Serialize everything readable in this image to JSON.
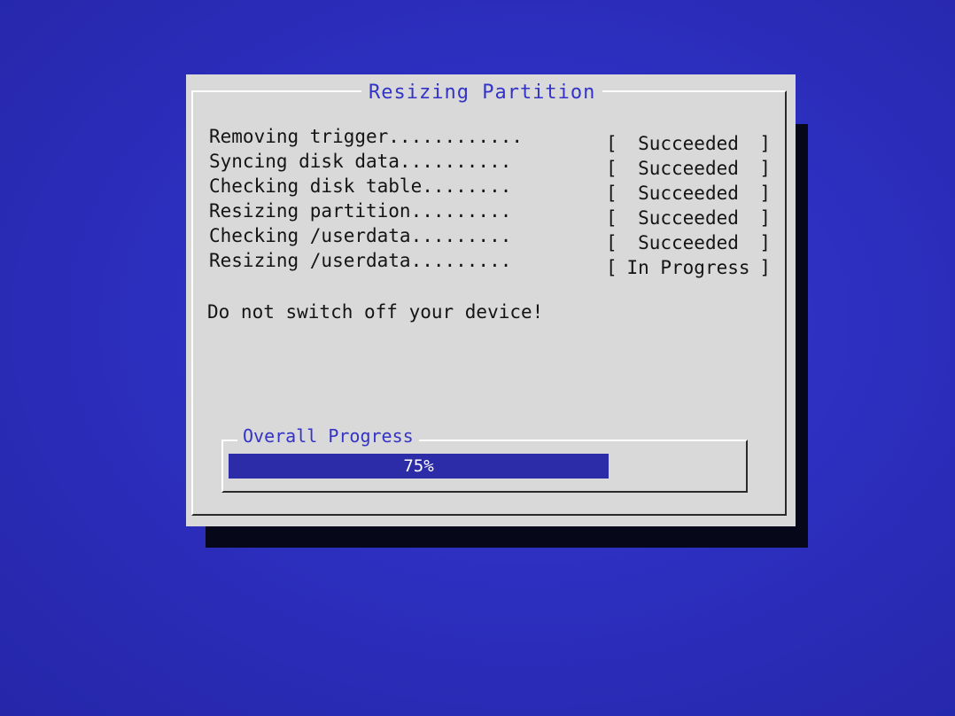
{
  "dialog": {
    "title": "Resizing Partition"
  },
  "tasks": [
    {
      "label": "Removing trigger............",
      "status": "Succeeded"
    },
    {
      "label": "Syncing disk data..........",
      "status": "Succeeded"
    },
    {
      "label": "Checking disk table........",
      "status": "Succeeded"
    },
    {
      "label": "Resizing partition.........",
      "status": "Succeeded"
    },
    {
      "label": "Checking /userdata.........",
      "status": "Succeeded"
    },
    {
      "label": "Resizing /userdata.........",
      "status": "In Progress"
    }
  ],
  "brackets": {
    "open": "[",
    "close": "]"
  },
  "warning": "Do not switch off your device!",
  "progress": {
    "title": "Overall Progress",
    "fraction": 0.75,
    "label": "75%"
  },
  "colors": {
    "background": "#2d2fc0",
    "dialog": "#d9d9d9",
    "accent_text": "#3333c8",
    "progress_fill": "#2c2ca8",
    "shadow": "#07071a"
  }
}
